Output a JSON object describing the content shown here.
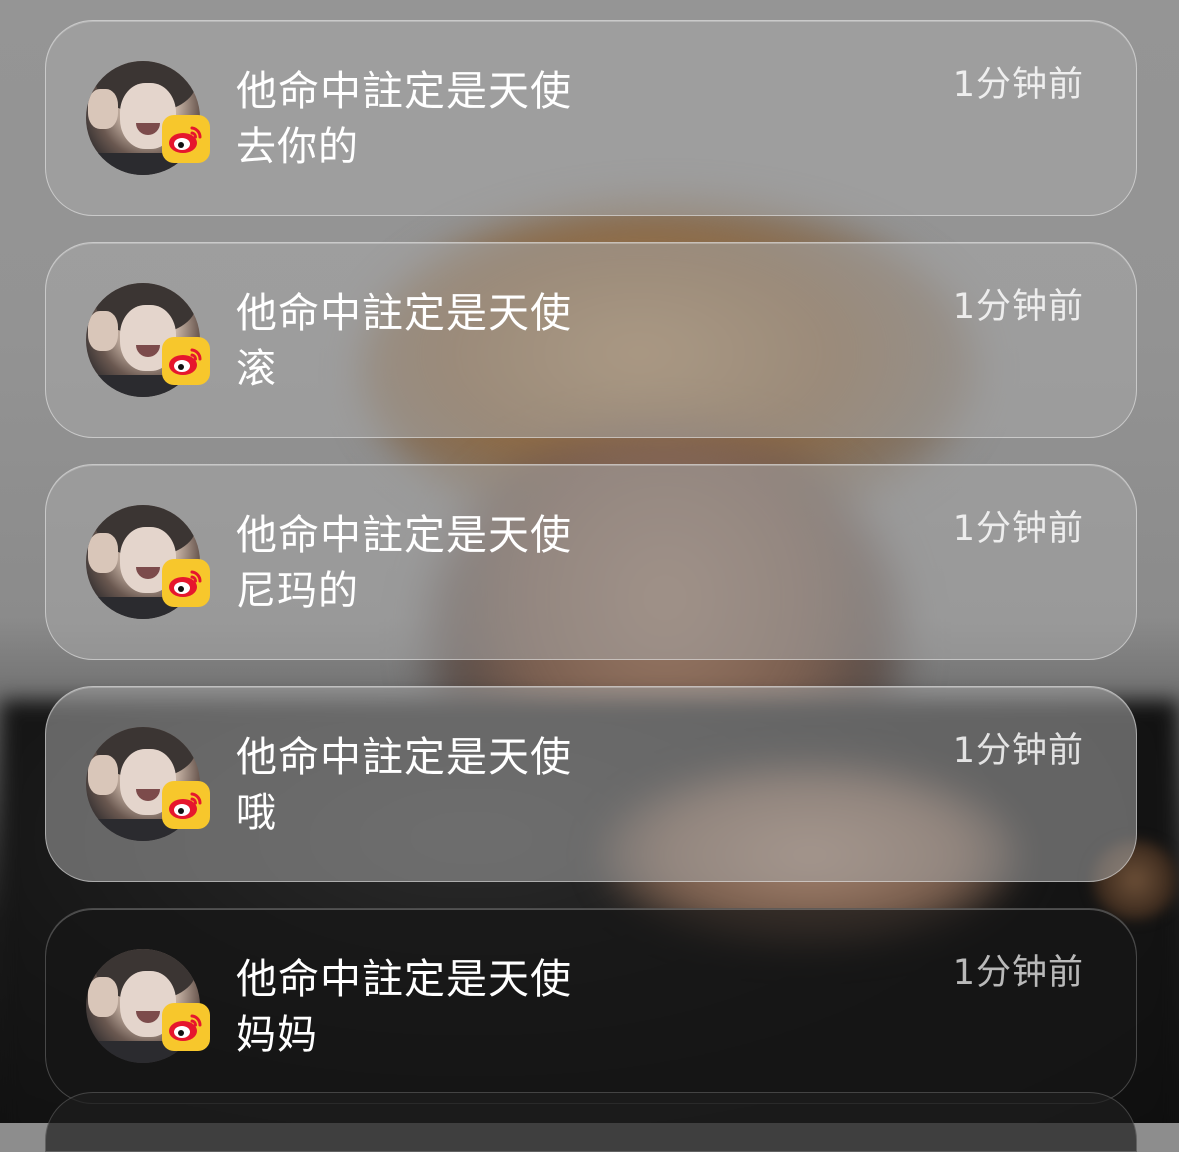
{
  "notifications": [
    {
      "title": "他命中註定是天使",
      "message": "去你的",
      "time": "1分钟前",
      "theme": "light",
      "app_icon": "weibo-icon"
    },
    {
      "title": "他命中註定是天使",
      "message": "滚",
      "time": "1分钟前",
      "theme": "light",
      "app_icon": "weibo-icon"
    },
    {
      "title": "他命中註定是天使",
      "message": "尼玛的",
      "time": "1分钟前",
      "theme": "light",
      "app_icon": "weibo-icon"
    },
    {
      "title": "他命中註定是天使",
      "message": "哦",
      "time": "1分钟前",
      "theme": "light",
      "app_icon": "weibo-icon"
    },
    {
      "title": "他命中註定是天使",
      "message": "妈妈",
      "time": "1分钟前",
      "theme": "dark",
      "app_icon": "weibo-icon"
    }
  ],
  "colors": {
    "badge_bg": "#f7c72c",
    "weibo_red": "#e6162d"
  }
}
